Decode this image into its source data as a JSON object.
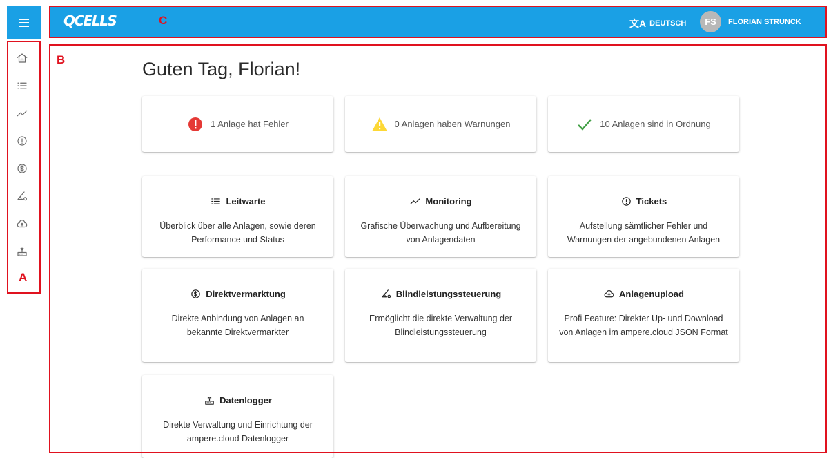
{
  "header": {
    "brand": "QCELLS",
    "language": "DEUTSCH",
    "user_initials": "FS",
    "user_name": "FLORIAN STRUNCK"
  },
  "annotations": {
    "a": "A",
    "b": "B",
    "c": "C"
  },
  "greeting": "Guten Tag, Florian!",
  "status": {
    "error": "1 Anlage hat Fehler",
    "warning": "0 Anlagen haben Warnungen",
    "ok": "10 Anlagen sind in Ordnung"
  },
  "features": [
    {
      "title": "Leitwarte",
      "desc": "Überblick über alle Anlagen, sowie deren Performance und Status",
      "icon": "list-icon"
    },
    {
      "title": "Monitoring",
      "desc": "Grafische Überwachung und Aufbereitung von Anlagendaten",
      "icon": "trend-icon"
    },
    {
      "title": "Tickets",
      "desc": "Aufstellung sämtlicher Fehler und Warnungen der angebundenen Anlagen",
      "icon": "alert-circle-icon"
    },
    {
      "title": "Direktvermarktung",
      "desc": "Direkte Anbindung von Anlagen an bekannte Direktvermarkter",
      "icon": "dollar-circle-icon"
    },
    {
      "title": "Blindleistungssteuerung",
      "desc": "Ermöglicht die direkte Verwaltung der Blindleistungssteuerung",
      "icon": "angle-gear-icon"
    },
    {
      "title": "Anlagenupload",
      "desc": "Profi Feature: Direkter Up- und Download von Anlagen im ampere.cloud JSON Format",
      "icon": "cloud-upload-icon"
    },
    {
      "title": "Datenlogger",
      "desc": "Direkte Verwaltung und Einrichtung der ampere.cloud Datenlogger",
      "icon": "router-icon"
    }
  ],
  "colors": {
    "brand": "#1aa0e5",
    "error": "#e53935",
    "warning": "#fdd835",
    "ok": "#43a047",
    "annotation": "#e0121f"
  }
}
